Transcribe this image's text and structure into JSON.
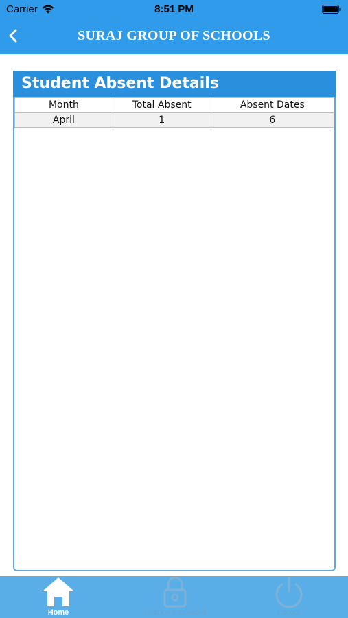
{
  "status_bar": {
    "carrier": "Carrier",
    "time": "8:51 PM"
  },
  "nav": {
    "title": "SURAJ GROUP OF SCHOOLS",
    "back_icon": "chevron-left-icon"
  },
  "card": {
    "title": "Student Absent Details",
    "columns": [
      "Month",
      "Total Absent",
      "Absent Dates"
    ],
    "rows": [
      {
        "month": "April",
        "total_absent": "1",
        "absent_dates": "6"
      }
    ]
  },
  "tab_bar": {
    "items": [
      {
        "label": "Home",
        "icon": "home-icon",
        "active": true
      },
      {
        "label": "Change Password",
        "icon": "lock-icon",
        "active": false
      },
      {
        "label": "Logout",
        "icon": "power-icon",
        "active": false
      }
    ]
  },
  "colors": {
    "primary": "#2f9bea",
    "card_header": "#2a8fdc",
    "tab_bar": "#5aaee8"
  }
}
